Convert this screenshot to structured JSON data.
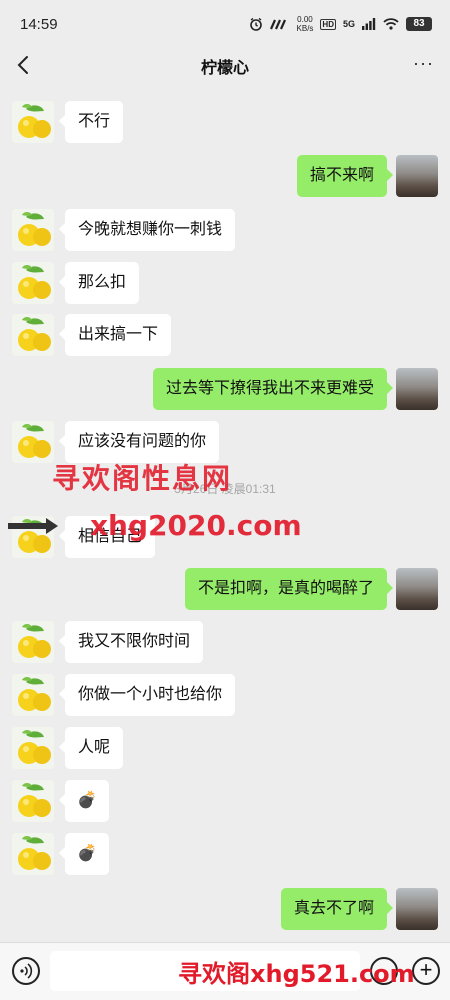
{
  "status_bar": {
    "time": "14:59",
    "speed_value": "0.00",
    "speed_unit": "KB/s",
    "network": "5G",
    "battery": "83"
  },
  "header": {
    "title": "柠檬心",
    "more_label": "···"
  },
  "timestamp": "3月26日 凌晨01:31",
  "messages": [
    {
      "side": "left",
      "text": "不行"
    },
    {
      "side": "right",
      "text": "搞不来啊"
    },
    {
      "side": "left",
      "text": "今晚就想赚你一刺钱"
    },
    {
      "side": "left",
      "text": "那么扣"
    },
    {
      "side": "left",
      "text": "出来搞一下"
    },
    {
      "side": "right",
      "text": "过去等下撩得我出不来更难受"
    },
    {
      "side": "left",
      "text": "应该没有问题的你"
    },
    {
      "side": "left",
      "text": "相信自己"
    },
    {
      "side": "right",
      "text": "不是扣啊，是真的喝醉了"
    },
    {
      "side": "left",
      "text": "我又不限你时间"
    },
    {
      "side": "left",
      "text": "你做一个小时也给你"
    },
    {
      "side": "left",
      "text": "人呢"
    },
    {
      "side": "left",
      "text": "💣"
    },
    {
      "side": "left",
      "text": "💣"
    },
    {
      "side": "right",
      "text": "真去不了啊"
    }
  ],
  "watermarks": {
    "line1": "寻欢阁性息网",
    "line2": "xhg2020.com",
    "line3": "寻欢阁xhg521.com"
  },
  "icons": {
    "back": "back-arrow-icon",
    "more": "more-icon",
    "voice": "voice-icon",
    "emoji": "emoji-icon",
    "plus": "plus-icon",
    "avatar_left": "lemon-avatar",
    "avatar_right": "sunset-photo-avatar"
  },
  "colors": {
    "background": "#ededed",
    "bubble_self": "#95ec69",
    "bubble_other": "#ffffff",
    "watermark": "#e21b2b"
  }
}
